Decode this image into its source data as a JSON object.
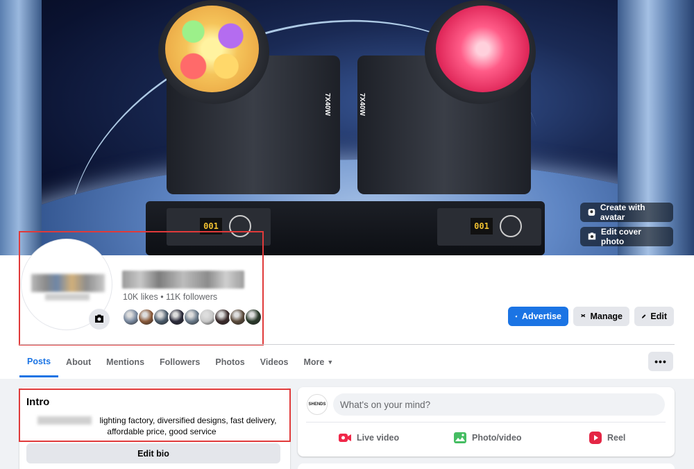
{
  "cover": {
    "create_avatar_label": "Create with avatar",
    "edit_cover_label": "Edit cover photo",
    "fixture_label": "7X40W",
    "display_value": "001"
  },
  "profile": {
    "stats": "10K likes • 11K followers",
    "follower_colors": [
      "#7a8aa0",
      "#8a5a3a",
      "#4a5a6a",
      "#2a2a3a",
      "#6a7a8a",
      "#c8c8c8",
      "#3a2a2a",
      "#5a4a3a",
      "#2a3a2a"
    ]
  },
  "actions": {
    "advertise": "Advertise",
    "manage": "Manage",
    "edit": "Edit"
  },
  "tabs": [
    {
      "label": "Posts"
    },
    {
      "label": "About"
    },
    {
      "label": "Mentions"
    },
    {
      "label": "Followers"
    },
    {
      "label": "Photos"
    },
    {
      "label": "Videos"
    },
    {
      "label": "More"
    }
  ],
  "more_dots": "•••",
  "intro": {
    "title": "Intro",
    "bio": "lighting factory, diversified designs, fast delivery, affordable price, good service",
    "edit_bio": "Edit bio"
  },
  "composer": {
    "avatar_text": "SHENDS",
    "placeholder": "What's on your mind?",
    "live_video": "Live video",
    "photo_video": "Photo/video",
    "reel": "Reel"
  },
  "colors": {
    "accent": "#1b74e4",
    "highlight_box": "#e03a3a",
    "live_icon": "#f02849",
    "photo_icon": "#45bd62",
    "reel_icon": "#e42645"
  }
}
